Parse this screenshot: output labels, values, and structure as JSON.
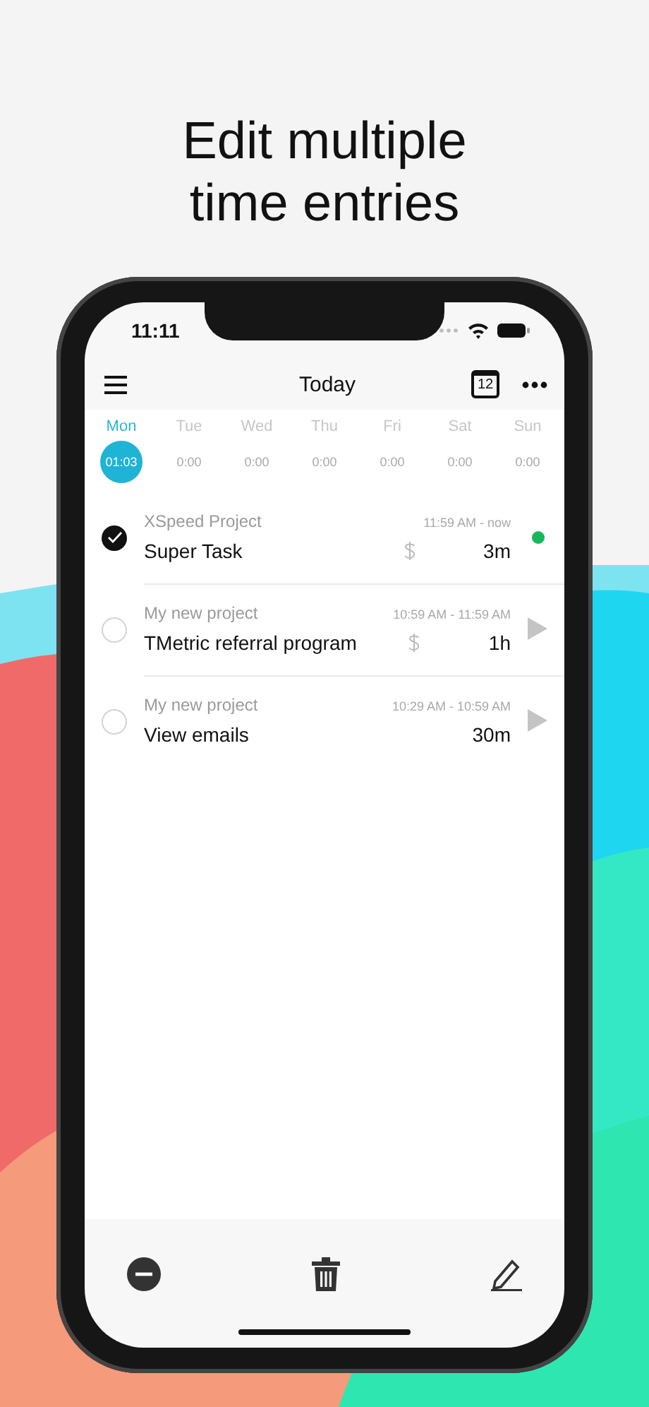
{
  "headline": "Edit multiple time entries",
  "status_bar": {
    "time": "11:11"
  },
  "nav": {
    "title": "Today",
    "calendar_day": "12"
  },
  "days": [
    {
      "name": "Mon",
      "hours": "01:03",
      "selected": true
    },
    {
      "name": "Tue",
      "hours": "0:00",
      "selected": false
    },
    {
      "name": "Wed",
      "hours": "0:00",
      "selected": false
    },
    {
      "name": "Thu",
      "hours": "0:00",
      "selected": false
    },
    {
      "name": "Fri",
      "hours": "0:00",
      "selected": false
    },
    {
      "name": "Sat",
      "hours": "0:00",
      "selected": false
    },
    {
      "name": "Sun",
      "hours": "0:00",
      "selected": false
    }
  ],
  "entries": [
    {
      "project": "XSpeed Project",
      "time_range": "11:59 AM - now",
      "task": "Super Task",
      "billable": true,
      "duration": "3m",
      "running": true,
      "selected": true
    },
    {
      "project": "My new project",
      "time_range": "10:59 AM - 11:59 AM",
      "task": "TMetric referral program",
      "billable": true,
      "duration": "1h",
      "running": false,
      "selected": false
    },
    {
      "project": "My new project",
      "time_range": "10:29 AM - 10:59 AM",
      "task": "View emails",
      "billable": false,
      "duration": "30m",
      "running": false,
      "selected": false
    }
  ]
}
